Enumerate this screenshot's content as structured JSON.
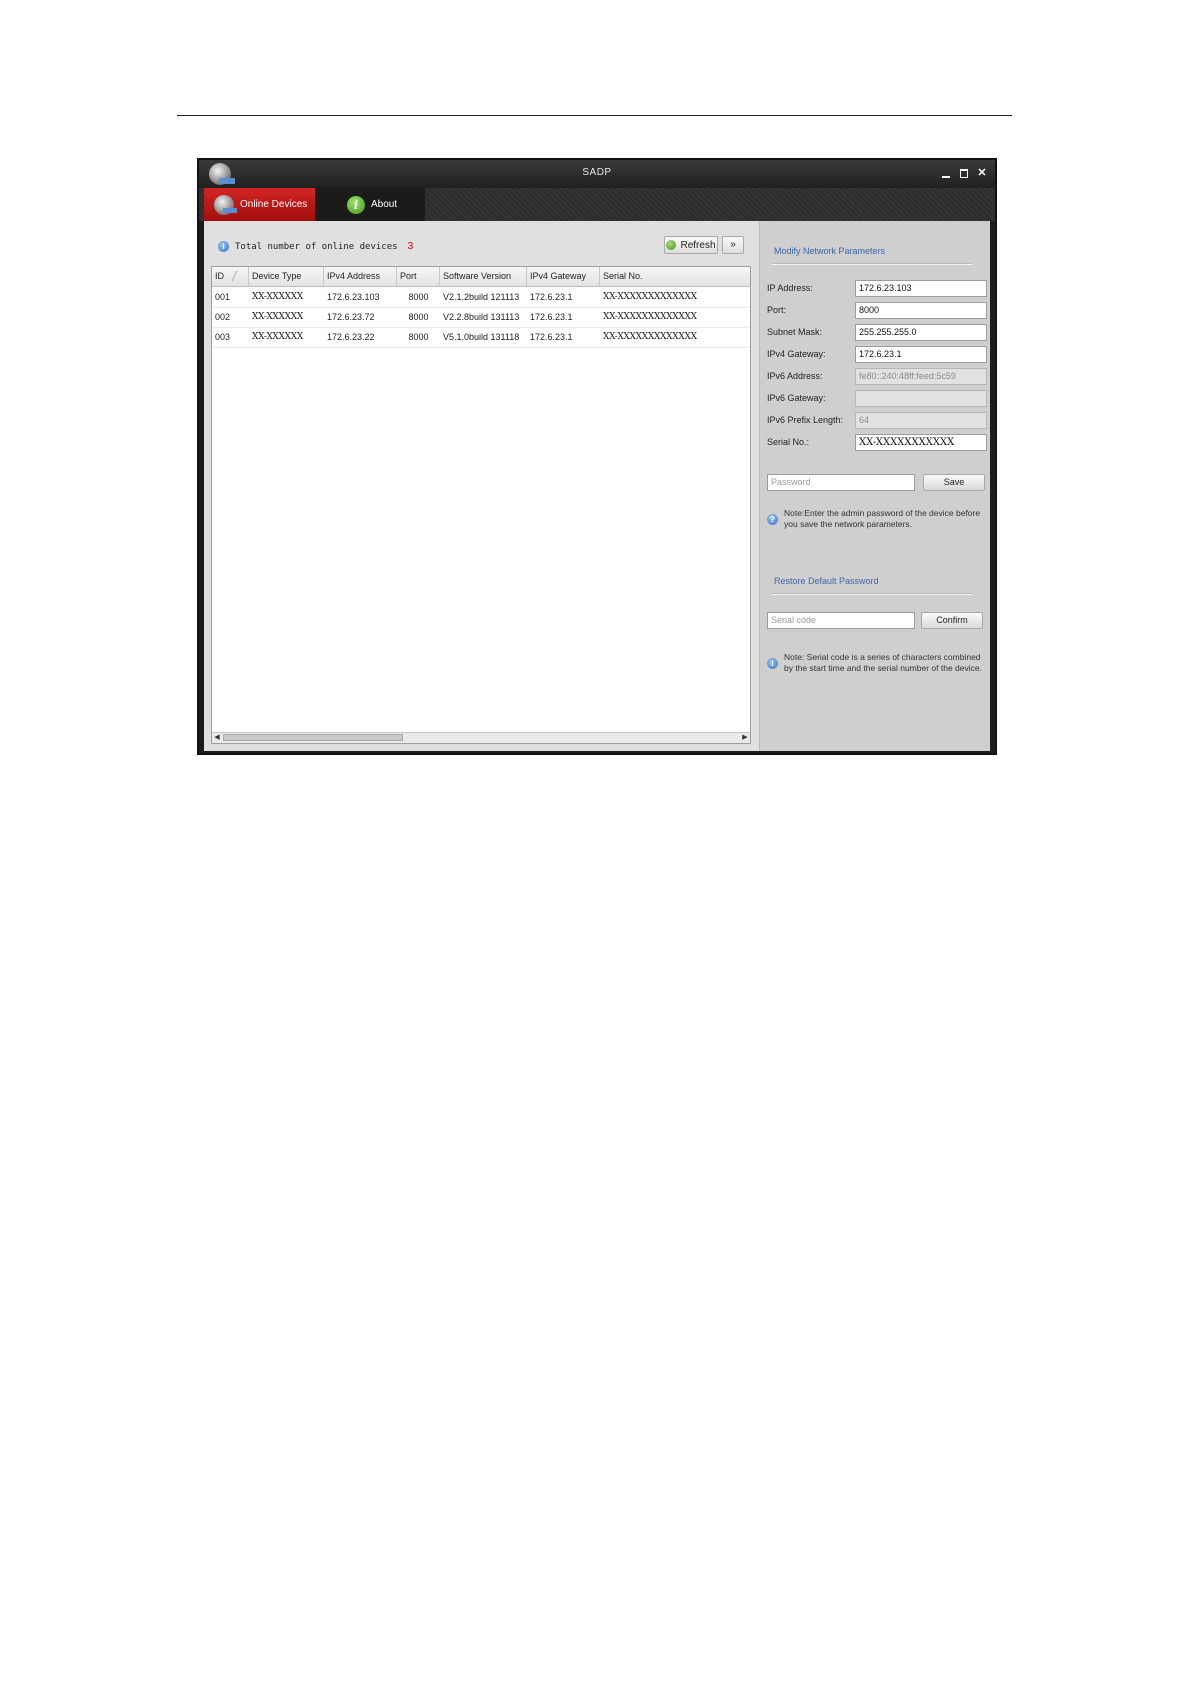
{
  "window": {
    "title": "SADP"
  },
  "tabs": [
    {
      "label": "Online Devices",
      "active": true
    },
    {
      "label": "About",
      "active": false
    }
  ],
  "toolbar": {
    "total_label": "Total number of online devices",
    "total_count": "3",
    "refresh_label": "Refresh",
    "expand_label": "»"
  },
  "table": {
    "columns": [
      "ID",
      "Device Type",
      "IPv4 Address",
      "Port",
      "Software Version",
      "IPv4 Gateway",
      "Serial No."
    ],
    "rows": [
      [
        "001",
        "XX-XXXXXX",
        "172.6.23.103",
        "8000",
        "V2.1.2build 121113",
        "172.6.23.1",
        "XX-XXXXXXXXXXXXX"
      ],
      [
        "002",
        "XX-XXXXXX",
        "172.6.23.72",
        "8000",
        "V2.2.8build 131113",
        "172.6.23.1",
        "XX-XXXXXXXXXXXXX"
      ],
      [
        "003",
        "XX-XXXXXX",
        "172.6.23.22",
        "8000",
        "V5.1.0build 131118",
        "172.6.23.1",
        "XX-XXXXXXXXXXXXX"
      ]
    ]
  },
  "modify": {
    "title": "Modify Network Parameters",
    "fields": [
      {
        "label": "IP Address:",
        "value": "172.6.23.103",
        "disabled": false
      },
      {
        "label": "Port:",
        "value": "8000",
        "disabled": false
      },
      {
        "label": "Subnet Mask:",
        "value": "255.255.255.0",
        "disabled": false
      },
      {
        "label": "IPv4 Gateway:",
        "value": "172.6.23.1",
        "disabled": false
      },
      {
        "label": "IPv6 Address:",
        "value": "fe80::240:48ff:feed:5c59",
        "disabled": true
      },
      {
        "label": "IPv6 Gateway:",
        "value": "",
        "disabled": true
      },
      {
        "label": "IPv6 Prefix Length:",
        "value": "64",
        "disabled": true
      },
      {
        "label": "Serial No.:",
        "value": "XX-XXXXXXXXXXX",
        "disabled": false
      }
    ],
    "password_placeholder": "Password",
    "save_label": "Save",
    "note": "Note:Enter the admin password of the device before you save the network parameters."
  },
  "restore": {
    "title": "Restore Default Password",
    "serial_placeholder": "Serial code",
    "confirm_label": "Confirm",
    "note": "Note: Serial code is a series of characters combined by the start time and the serial number of the device."
  },
  "icons": {
    "app": "globe-icon",
    "online_tab": "globe-icon",
    "about_tab": "info-icon",
    "refresh": "refresh-icon",
    "info": "info-icon"
  },
  "colors": {
    "active_tab": "#c41a1a",
    "count": "#dd0000",
    "section_title": "#3a67a9"
  }
}
